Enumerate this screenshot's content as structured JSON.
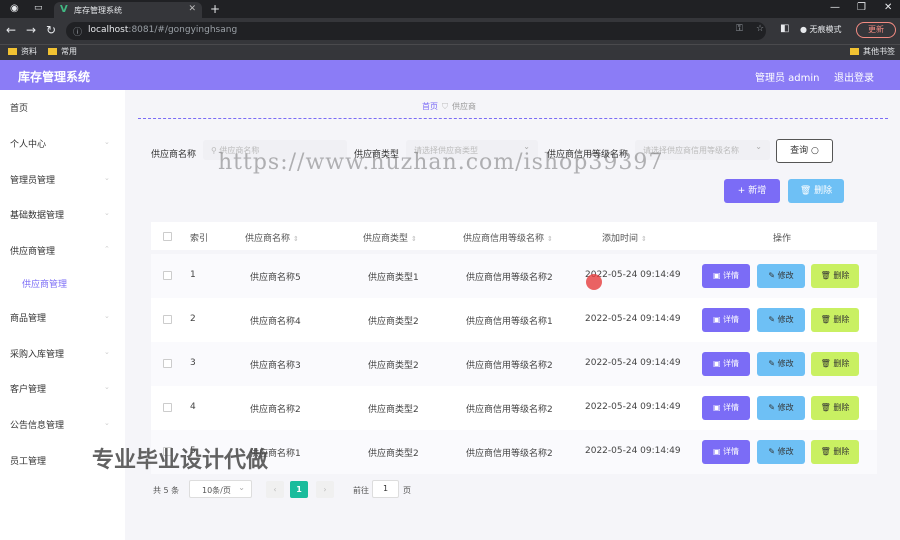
{
  "browser": {
    "tab_title": "库存管理系统",
    "url_host": "localhost",
    "url_path": ":8081/#/gongyinghsang",
    "incognito_label": "无痕模式",
    "update_label": "更新",
    "bookmarks": [
      "资料",
      "常用"
    ],
    "other_bookmarks": "其他书签"
  },
  "app": {
    "title": "库存管理系统",
    "admin_label": "管理员 admin",
    "logout_label": "退出登录"
  },
  "sidebar": {
    "items": [
      "首页",
      "个人中心",
      "管理员管理",
      "基础数据管理",
      "供应商管理",
      "供应商管理",
      "商品管理",
      "采购入库管理",
      "客户管理",
      "公告信息管理",
      "员工管理"
    ]
  },
  "breadcrumb": {
    "home": "首页",
    "current": "供应商"
  },
  "filters": {
    "name_label": "供应商名称",
    "name_placeholder": "供应商名称",
    "type_label": "供应商类型",
    "type_placeholder": "请选择供应商类型",
    "level_label": "供应商信用等级名称",
    "level_placeholder": "请选择供应商信用等级名称",
    "query_label": "查询"
  },
  "actions": {
    "add_label": "新增",
    "delete_label": "删除"
  },
  "table": {
    "headers": [
      "索引",
      "供应商名称",
      "供应商类型",
      "供应商信用等级名称",
      "添加时间",
      "操作"
    ],
    "rows": [
      [
        "1",
        "供应商名称5",
        "供应商类型1",
        "供应商信用等级名称2",
        "2022-05-24 09:14:49"
      ],
      [
        "2",
        "供应商名称4",
        "供应商类型2",
        "供应商信用等级名称1",
        "2022-05-24 09:14:49"
      ],
      [
        "3",
        "供应商名称3",
        "供应商类型2",
        "供应商信用等级名称2",
        "2022-05-24 09:14:49"
      ],
      [
        "4",
        "供应商名称2",
        "供应商类型2",
        "供应商信用等级名称2",
        "2022-05-24 09:14:49"
      ],
      [
        "5",
        "供应商名称1",
        "供应商类型2",
        "供应商信用等级名称2",
        "2022-05-24 09:14:49"
      ]
    ],
    "op_detail": "详情",
    "op_edit": "修改",
    "op_delete": "删除"
  },
  "pagination": {
    "total_label": "共 5 条",
    "page_size": "10条/页",
    "current_page": "1",
    "goto_label": "前往",
    "goto_value": "1",
    "page_suffix": "页"
  },
  "watermarks": {
    "url": "https://www.huzhan.com/ishop39397",
    "text": "专业毕业设计代做"
  }
}
